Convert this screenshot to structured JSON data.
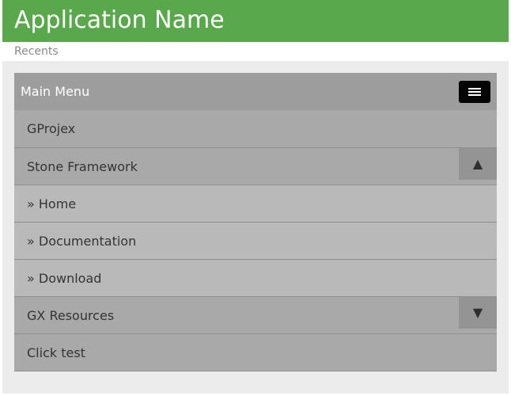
{
  "header": {
    "app_title": "Application Name",
    "accent_color": "#59a84b"
  },
  "recents": {
    "label": "Recents"
  },
  "menu": {
    "title": "Main Menu",
    "toggle_icon": "hamburger-icon",
    "items": [
      {
        "label": "GProjex",
        "level": 1
      },
      {
        "label": "Stone Framework",
        "level": 1,
        "expander": "▲",
        "expander_icon": "collapse-up-icon",
        "expanded": true
      },
      {
        "label": "» Home",
        "level": 2
      },
      {
        "label": "» Documentation",
        "level": 2
      },
      {
        "label": "» Download",
        "level": 2
      },
      {
        "label": "GX Resources",
        "level": 1,
        "expander": "▼",
        "expander_icon": "expand-down-icon",
        "expanded": false
      },
      {
        "label": "Click test",
        "level": 1
      }
    ]
  }
}
